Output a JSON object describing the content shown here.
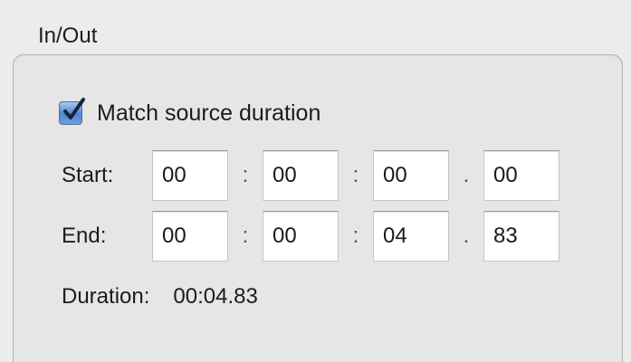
{
  "group": {
    "title": "In/Out"
  },
  "match_source": {
    "label": "Match source duration",
    "checked": true
  },
  "start": {
    "label": "Start:",
    "hours": "00",
    "minutes": "00",
    "seconds": "00",
    "frames": "00"
  },
  "end": {
    "label": "End:",
    "hours": "00",
    "minutes": "00",
    "seconds": "04",
    "frames": "83"
  },
  "separators": {
    "colon": ":",
    "dot": "."
  },
  "duration": {
    "label": "Duration:",
    "value": "00:04.83"
  },
  "icons": {
    "checkbox": "checkmark-icon"
  },
  "colors": {
    "checkbox_fill": "#4e86cf",
    "window_bg": "#ececec"
  }
}
